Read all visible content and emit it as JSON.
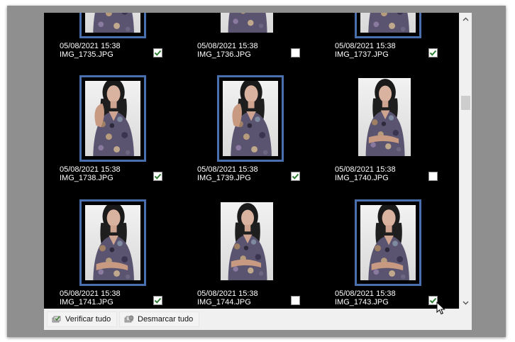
{
  "buttons": {
    "check_all": "Verificar tudo",
    "uncheck_all": "Desmarcar tudo"
  },
  "colors": {
    "grid_background": "#000000",
    "selection_border": "#4a6faf",
    "check_mark": "#2e7d32"
  },
  "icons": {
    "scroll_up": "chevron-up-icon",
    "scroll_down": "chevron-down-icon",
    "check_all": "check-all-icon",
    "uncheck_all": "uncheck-all-icon",
    "cursor": "mouse-pointer-icon"
  },
  "photos": [
    {
      "date": "05/08/2021 15:38",
      "name": "IMG_1735.JPG",
      "checked": true,
      "selected": true,
      "pose": "arm"
    },
    {
      "date": "05/08/2021 15:38",
      "name": "IMG_1736.JPG",
      "checked": false,
      "selected": false,
      "pose": "arm"
    },
    {
      "date": "05/08/2021 15:38",
      "name": "IMG_1737.JPG",
      "checked": true,
      "selected": true,
      "pose": "arm"
    },
    {
      "date": "05/08/2021 15:38",
      "name": "IMG_1738.JPG",
      "checked": true,
      "selected": true,
      "pose": "arm"
    },
    {
      "date": "05/08/2021 15:38",
      "name": "IMG_1739.JPG",
      "checked": true,
      "selected": true,
      "pose": "arm"
    },
    {
      "date": "05/08/2021 15:38",
      "name": "IMG_1740.JPG",
      "checked": false,
      "selected": false,
      "pose": "cross"
    },
    {
      "date": "05/08/2021 15:38",
      "name": "IMG_1741.JPG",
      "checked": true,
      "selected": true,
      "pose": "cross"
    },
    {
      "date": "05/08/2021 15:38",
      "name": "IMG_1744.JPG",
      "checked": false,
      "selected": false,
      "pose": "cross"
    },
    {
      "date": "05/08/2021 15:38",
      "name": "IMG_1743.JPG",
      "checked": true,
      "selected": true,
      "pose": "cross"
    }
  ]
}
